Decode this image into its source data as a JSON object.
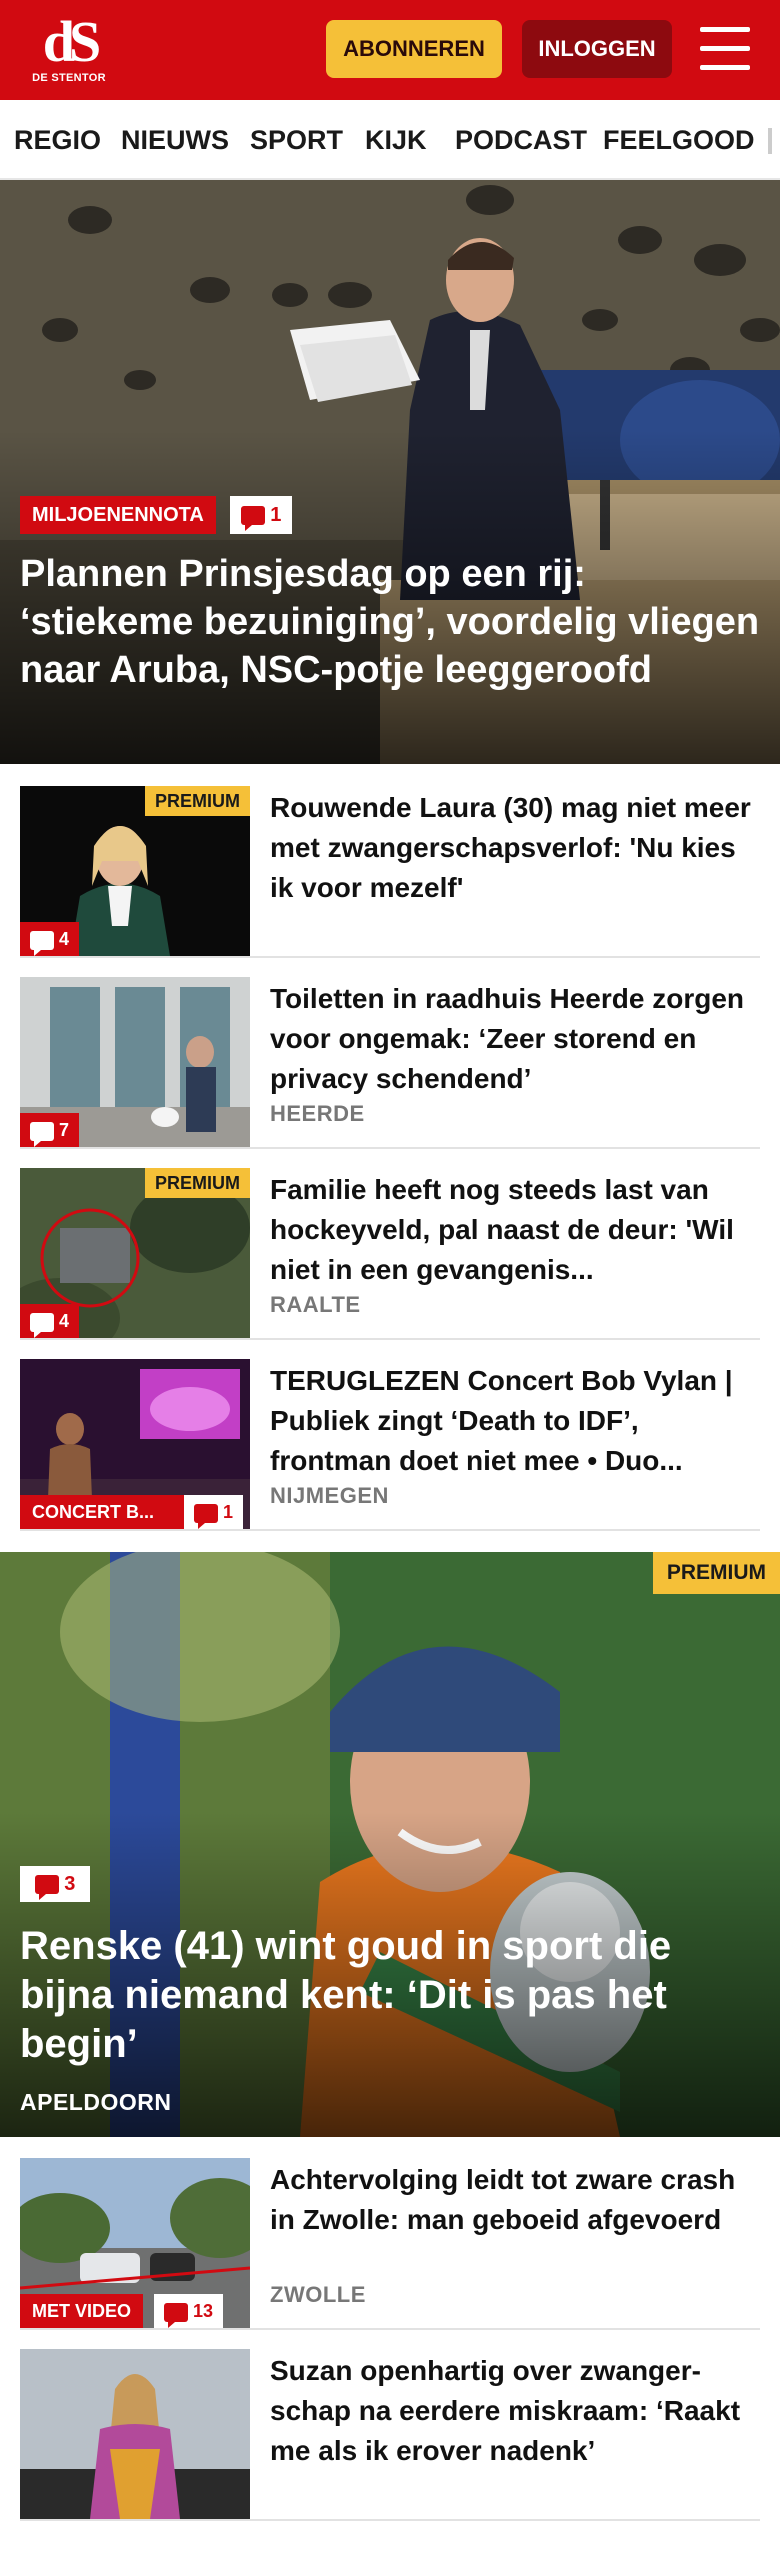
{
  "header": {
    "logo_mark": "dS",
    "logo_text": "DE STENTOR",
    "subscribe_label": "ABONNEREN",
    "login_label": "INLOGGEN",
    "menu_icon": "hamburger-menu-icon",
    "colors": {
      "brand_red": "#d10a11",
      "subscribe_yellow": "#f5c038",
      "login_dark_red": "#8d0a0f"
    }
  },
  "nav": {
    "items": [
      "REGIO",
      "NIEUWS",
      "SPORT",
      "KIJK",
      "PODCAST",
      "FEELGOOD"
    ]
  },
  "hero": {
    "tag": "MILJOENENNOTA",
    "comments": "1",
    "title": "Plannen Prinsjesdag op een rij: ‘stiekeme bezuiniging’, voordelig vliegen naar Aruba, NSC-potje leegge­roofd"
  },
  "articles": [
    {
      "title": "Rouwende Laura (30) mag niet meer met zwangerschapsverlof: 'Nu kies ik voor mezelf'",
      "category": "",
      "premium": "PREMIUM",
      "comments": "4"
    },
    {
      "title": "Toiletten in raadhuis Heerde zorgen voor ongemak: ‘Zeer storend en privacy schendend’",
      "category": "HEERDE",
      "premium": "",
      "comments": "7"
    },
    {
      "title": "Familie heeft nog steeds last van hockeyveld, pal naast de deur: 'Wil niet in een gevangenis...",
      "category": "RAALTE",
      "premium": "PREMIUM",
      "comments": "4"
    },
    {
      "title": "TERUGLEZEN Concert Bob Vylan | Publiek zingt ‘Death to IDF’, frontman doet niet mee • Duo...",
      "category": "NIJMEGEN",
      "premium": "",
      "tag": "CONCERT B...",
      "comments": "1"
    }
  ],
  "feature": {
    "premium": "PREMIUM",
    "comments": "3",
    "title": "Renske (41) wint goud in sport die bijna niemand kent: ‘Dit is pas het begin’",
    "category": "APELDOORN"
  },
  "articles2": [
    {
      "title": "Achtervolging leidt tot zware crash in Zwolle: man geboeid afgevoerd",
      "category": "ZWOLLE",
      "tag": "MET VIDEO",
      "comments": "13"
    },
    {
      "title": "Suzan openhartig over zwanger­schap na eerdere miskraam: ‘Raakt me als ik erover nadenk’",
      "category": ""
    }
  ]
}
